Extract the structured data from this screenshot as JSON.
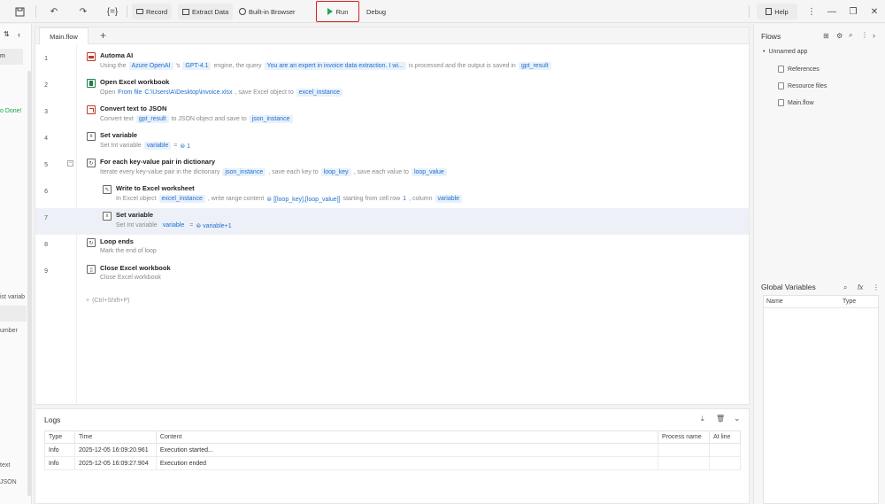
{
  "toolbar": {
    "record_label": "Record",
    "extract_label": "Extract Data",
    "browser_label": "Built-in Browser",
    "run_label": "Run",
    "debug_label": "Debug",
    "help_label": "Help"
  },
  "left_strip": {
    "item_1": "m",
    "item_2": "o Done!",
    "item_3": "ist variab",
    "item_4": "umber",
    "item_5": "text",
    "item_6": "JSON"
  },
  "editor": {
    "tab_label": "Main.flow",
    "add_step_hint": "(Ctrl+Shift+P)",
    "steps": [
      {
        "num": "1",
        "title": "Automa AI",
        "desc": {
          "t1": "Using the",
          "c1": "Azure OpenAI",
          "t2": "'s",
          "c2": "GPT-4.1",
          "t3": "engine, the query",
          "c3": "You are an expert in invoice data extraction. I wi...",
          "t4": "is processed and the output is saved in",
          "c4": "gpt_result"
        }
      },
      {
        "num": "2",
        "title": "Open Excel workbook",
        "desc": {
          "t1": "Open",
          "c1": "From file",
          "c2": "C:\\Users\\A\\Desktop\\invoice.xlsx",
          "t2": ", save Excel object to",
          "c3": "excel_instance"
        }
      },
      {
        "num": "3",
        "title": "Convert text to JSON",
        "desc": {
          "t1": "Convert text",
          "c1": "gpt_result",
          "t2": "to JSON object and save to",
          "c2": "json_instance"
        }
      },
      {
        "num": "4",
        "title": "Set variable",
        "desc": {
          "t1": "Set Int variable",
          "c1": "variable",
          "t2": "=",
          "c2": "⊜ 1"
        }
      },
      {
        "num": "5",
        "title": "For each key-value pair in dictionary",
        "desc": {
          "t1": "Iterate every key-value pair in the dictionary",
          "c1": "json_instance",
          "t2": ", save each key to",
          "c2": "loop_key",
          "t3": ", save each value to",
          "c3": "loop_value"
        }
      },
      {
        "num": "6",
        "title": "Write to Excel worksheet",
        "desc": {
          "t1": "In Excel object",
          "c1": "excel_instance",
          "t2": ", write range content",
          "c2": "⊜ [[loop_key],[loop_value]]",
          "t3": "starting from cell row",
          "c3": "1",
          "t4": ", column",
          "c4": "variable"
        }
      },
      {
        "num": "7",
        "title": "Set variable",
        "desc": {
          "t1": "Set Int variable",
          "c1": "variable",
          "t2": "=",
          "c2": "⊜ variable+1"
        }
      },
      {
        "num": "8",
        "title": "Loop ends",
        "desc": {
          "t1": "Mark the end of loop"
        }
      },
      {
        "num": "9",
        "title": "Close Excel workbook",
        "desc": {
          "t1": "Close Excel workbook"
        }
      }
    ]
  },
  "logs": {
    "title": "Logs",
    "columns": [
      "Type",
      "Time",
      "Content",
      "Process name",
      "At line"
    ],
    "rows": [
      [
        "Info",
        "2025-12-05 16:09:20.961",
        "Execution started...",
        "",
        ""
      ],
      [
        "Info",
        "2025-12-05 16:09:27.904",
        "Execution ended",
        "",
        ""
      ]
    ]
  },
  "right_panel": {
    "flows_title": "Flows",
    "app_name": "Unnamed app",
    "references": "References",
    "resource_files": "Resource files",
    "main_flow": "Main.flow",
    "gv_title": "Global Variables",
    "gv_col_name": "Name",
    "gv_col_type": "Type"
  },
  "colors": {
    "accent": "#1f6fd1",
    "run_green": "#1faa4a",
    "highlight_border": "#d62020",
    "log_done_green": "#18a34a"
  }
}
